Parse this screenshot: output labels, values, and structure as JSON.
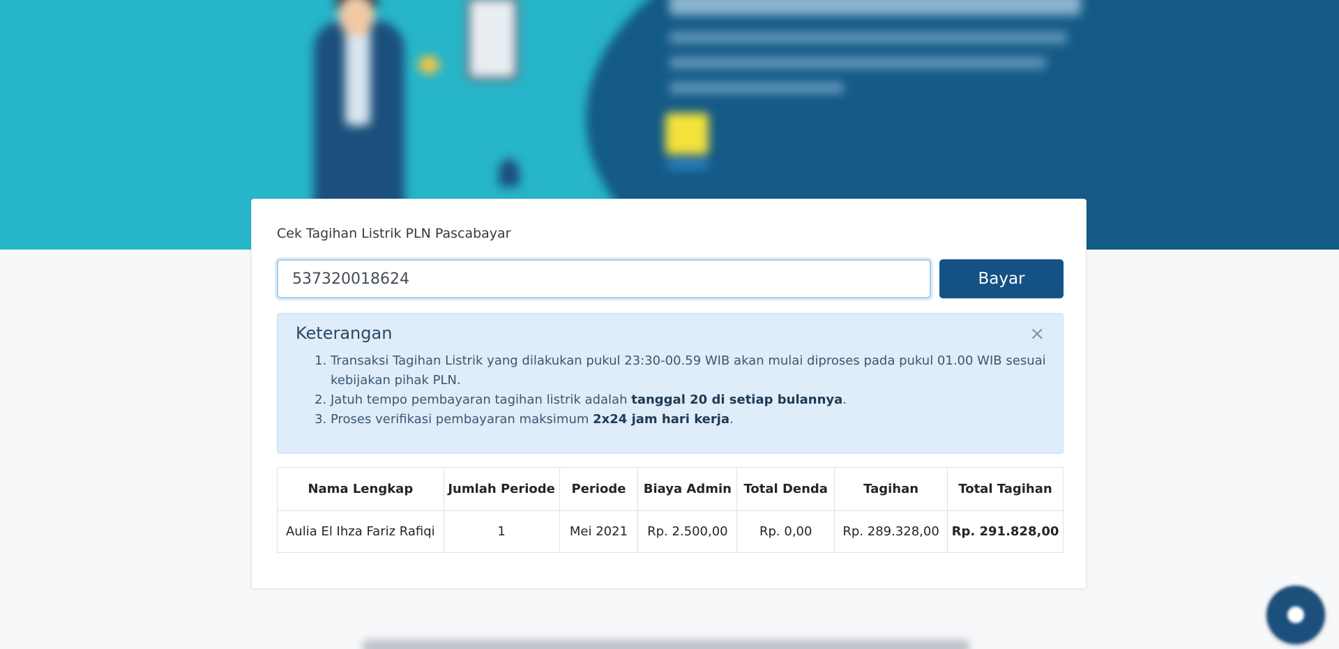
{
  "form": {
    "title": "Cek Tagihan Listrik PLN Pascabayar",
    "customer_id_value": "537320018624",
    "pay_button_label": "Bayar"
  },
  "notice": {
    "title": "Keterangan",
    "close_symbol": "×",
    "items": [
      {
        "text": "Transaksi Tagihan Listrik yang dilakukan pukul 23:30-00.59 WIB akan mulai diproses pada pukul 01.00 WIB sesuai kebijakan pihak PLN.",
        "bold": "",
        "suffix": ""
      },
      {
        "text": "Jatuh tempo pembayaran tagihan listrik adalah ",
        "bold": "tanggal 20 di setiap bulannya",
        "suffix": "."
      },
      {
        "text": "Proses verifikasi pembayaran maksimum ",
        "bold": "2x24 jam hari kerja",
        "suffix": "."
      }
    ]
  },
  "bill_table": {
    "headers": [
      "Nama Lengkap",
      "Jumlah Periode",
      "Periode",
      "Biaya Admin",
      "Total Denda",
      "Tagihan",
      "Total Tagihan"
    ],
    "rows": [
      [
        "Aulia El Ihza Fariz Rafiqi",
        "1",
        "Mei 2021",
        "Rp. 2.500,00",
        "Rp. 0,00",
        "Rp. 289.328,00",
        "Rp. 291.828,00"
      ]
    ]
  },
  "colors": {
    "hero_teal": "#27b5c9",
    "hero_navy": "#145a86",
    "primary_button": "#145285",
    "info_background": "#deedf9"
  },
  "icons": {
    "close": "close-icon",
    "chat": "chat-icon"
  }
}
